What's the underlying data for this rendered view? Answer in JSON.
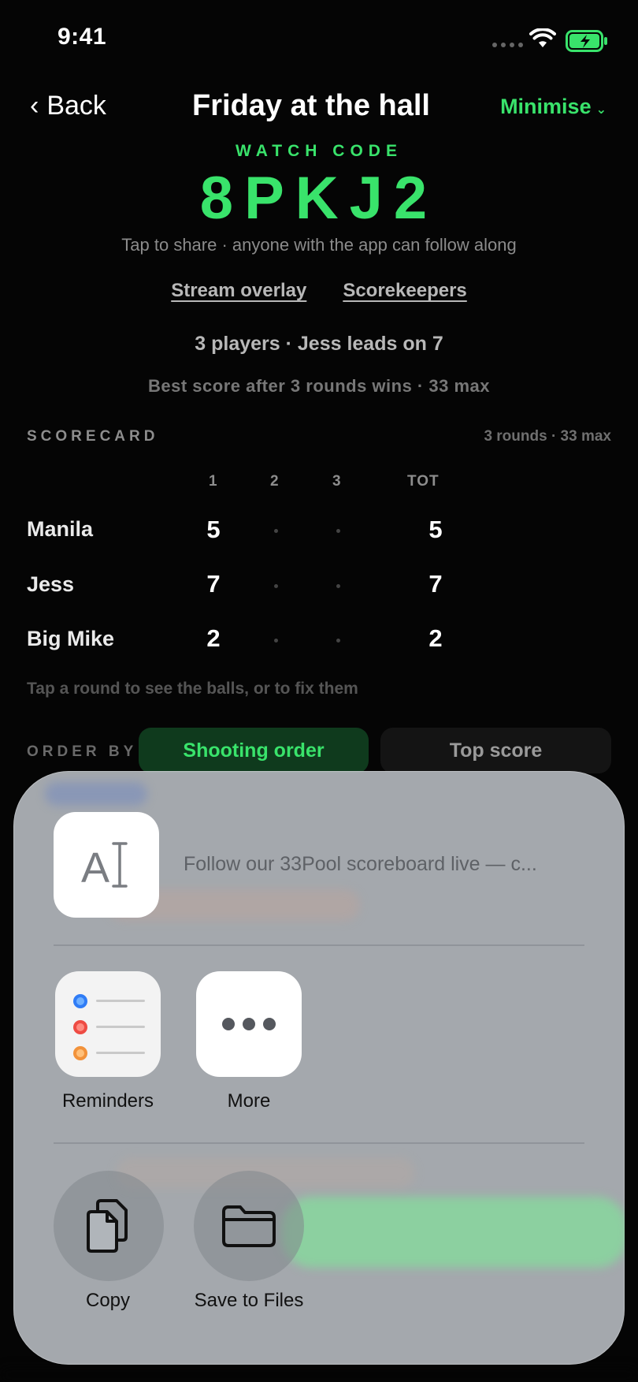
{
  "status_bar": {
    "time": "9:41"
  },
  "header": {
    "back_label": "Back",
    "title": "Friday at the hall",
    "minimise_label": "Minimise"
  },
  "watch": {
    "label": "WATCH CODE",
    "code": "8PKJ2",
    "hint": "Tap to share · anyone with the app can follow along"
  },
  "links": {
    "stream_overlay": "Stream overlay",
    "scorekeepers": "Scorekeepers"
  },
  "summary": "3 players · Jess leads on 7",
  "rules": "Best score after 3 rounds wins · 33 max",
  "scorecard": {
    "label": "SCORECARD",
    "meta": "3 rounds · 33 max",
    "columns": [
      "1",
      "2",
      "3",
      "TOT"
    ],
    "rows": [
      {
        "name": "Manila",
        "r1": "5",
        "total": "5"
      },
      {
        "name": "Jess",
        "r1": "7",
        "total": "7"
      },
      {
        "name": "Big Mike",
        "r1": "2",
        "total": "2"
      }
    ],
    "hint": "Tap a round to see the balls, or to fix them"
  },
  "order_by": {
    "label": "ORDER BY",
    "option_active": "Shooting order",
    "option_inactive": "Top score"
  },
  "share_sheet": {
    "preview_text": "Follow our 33Pool scoreboard live — c...",
    "apps": [
      {
        "label": "Reminders",
        "icon": "reminders-icon"
      },
      {
        "label": "More",
        "icon": "more-icon"
      }
    ],
    "actions": [
      {
        "label": "Copy",
        "icon": "copy-icon"
      },
      {
        "label": "Save to Files",
        "icon": "folder-icon"
      }
    ]
  },
  "colors": {
    "accent": "#39e36b",
    "background": "#050505",
    "sheet": "#b0b5ba"
  }
}
